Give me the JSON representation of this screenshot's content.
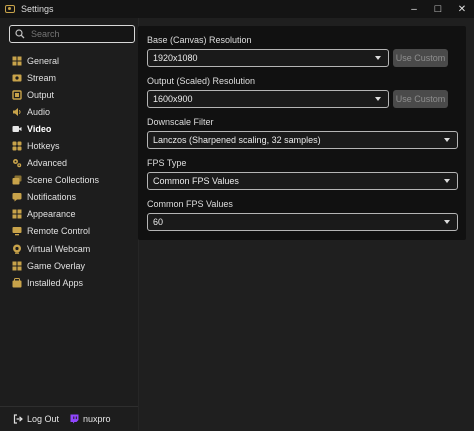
{
  "window": {
    "title": "Settings",
    "minimize": "–",
    "maximize": "□",
    "close": "✕"
  },
  "sidebar": {
    "search_placeholder": "Search",
    "items": [
      {
        "label": "General",
        "icon": "general-icon"
      },
      {
        "label": "Stream",
        "icon": "stream-icon"
      },
      {
        "label": "Output",
        "icon": "output-icon"
      },
      {
        "label": "Audio",
        "icon": "audio-icon"
      },
      {
        "label": "Video",
        "icon": "video-icon",
        "active": true
      },
      {
        "label": "Hotkeys",
        "icon": "hotkeys-icon"
      },
      {
        "label": "Advanced",
        "icon": "advanced-icon"
      },
      {
        "label": "Scene Collections",
        "icon": "scene-collections-icon"
      },
      {
        "label": "Notifications",
        "icon": "notifications-icon"
      },
      {
        "label": "Appearance",
        "icon": "appearance-icon"
      },
      {
        "label": "Remote Control",
        "icon": "remote-control-icon"
      },
      {
        "label": "Virtual Webcam",
        "icon": "virtual-webcam-icon"
      },
      {
        "label": "Game Overlay",
        "icon": "game-overlay-icon"
      },
      {
        "label": "Installed Apps",
        "icon": "installed-apps-icon"
      }
    ],
    "footer": {
      "logout_label": "Log Out",
      "username": "nuxpro"
    }
  },
  "video": {
    "base_resolution": {
      "label": "Base (Canvas) Resolution",
      "value": "1920x1080",
      "button": "Use Custom"
    },
    "output_resolution": {
      "label": "Output (Scaled) Resolution",
      "value": "1600x900",
      "button": "Use Custom"
    },
    "downscale_filter": {
      "label": "Downscale Filter",
      "value": "Lanczos (Sharpened scaling, 32 samples)"
    },
    "fps_type": {
      "label": "FPS Type",
      "value": "Common FPS Values"
    },
    "common_fps": {
      "label": "Common FPS Values",
      "value": "60"
    }
  },
  "colors": {
    "accent": "#c8a34a",
    "panel": "#111111",
    "background": "#1f1f1f",
    "sidebar": "#1d1d1d"
  }
}
